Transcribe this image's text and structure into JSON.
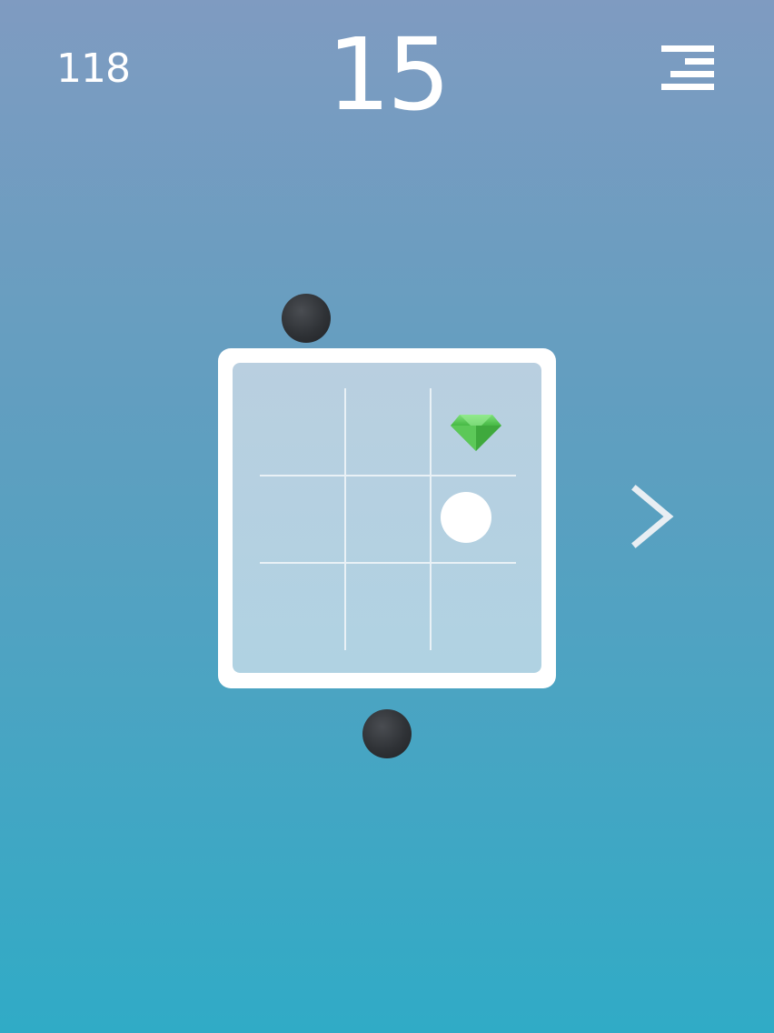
{
  "hud": {
    "gems": "118",
    "score": "15"
  },
  "icons": {
    "menu": "menu-icon",
    "next": "chevron-right-icon",
    "gem": "green-gem-icon"
  },
  "colors": {
    "background_top": "#7f9bc1",
    "background_bottom": "#30abc6",
    "board_frame": "#ffffff",
    "board_inner_top": "#b9cfe0",
    "board_inner_bottom": "#b0d2e2",
    "grid_line": "#e9f1f6",
    "player_ball": "#ffffff",
    "enemy_ball": "#2f3236",
    "gem": "#4cc24a"
  },
  "board": {
    "rows": 3,
    "cols": 3,
    "player_cell": {
      "row": 2,
      "col": 3
    },
    "gem_cell": {
      "row": 1,
      "col": 3
    }
  }
}
